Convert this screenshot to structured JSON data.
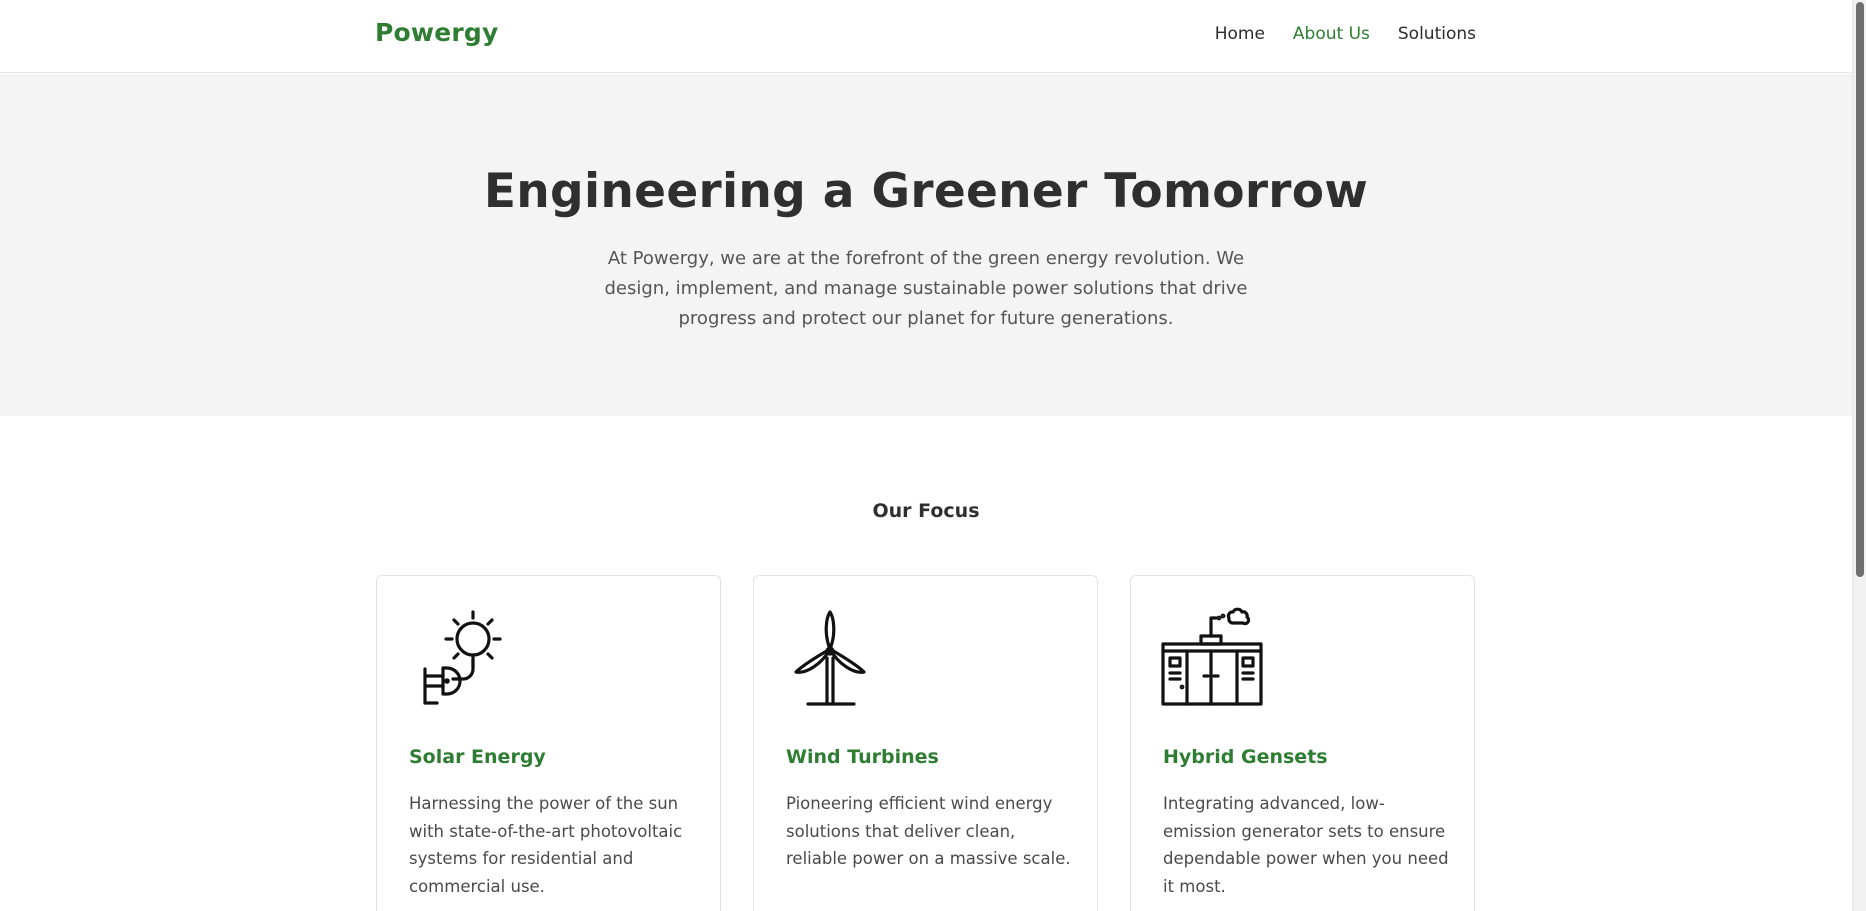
{
  "header": {
    "logo": "Powergy",
    "nav": [
      {
        "label": "Home"
      },
      {
        "label": "About Us",
        "active": true
      },
      {
        "label": "Solutions"
      }
    ]
  },
  "hero": {
    "title": "Engineering a Greener Tomorrow",
    "text": "At Powergy, we are at the forefront of the green energy revolution. We design, implement, and manage sustainable power solutions that drive progress and protect our planet for future generations."
  },
  "focus": {
    "title": "Our Focus",
    "cards": [
      {
        "icon": "solar-plug-icon",
        "title": "Solar Energy",
        "text": "Harnessing the power of the sun with state-of-the-art photovoltaic systems for residential and commercial use."
      },
      {
        "icon": "wind-turbine-icon",
        "title": "Wind Turbines",
        "text": "Pioneering efficient wind energy solutions that deliver clean, reliable power on a massive scale."
      },
      {
        "icon": "generator-icon",
        "title": "Hybrid Gensets",
        "text": "Integrating advanced, low-emission generator sets to ensure dependable power when you need it most."
      }
    ]
  },
  "colors": {
    "brand": "#2e7d32",
    "hero_bg": "#f3f4f3",
    "text": "#333333"
  }
}
